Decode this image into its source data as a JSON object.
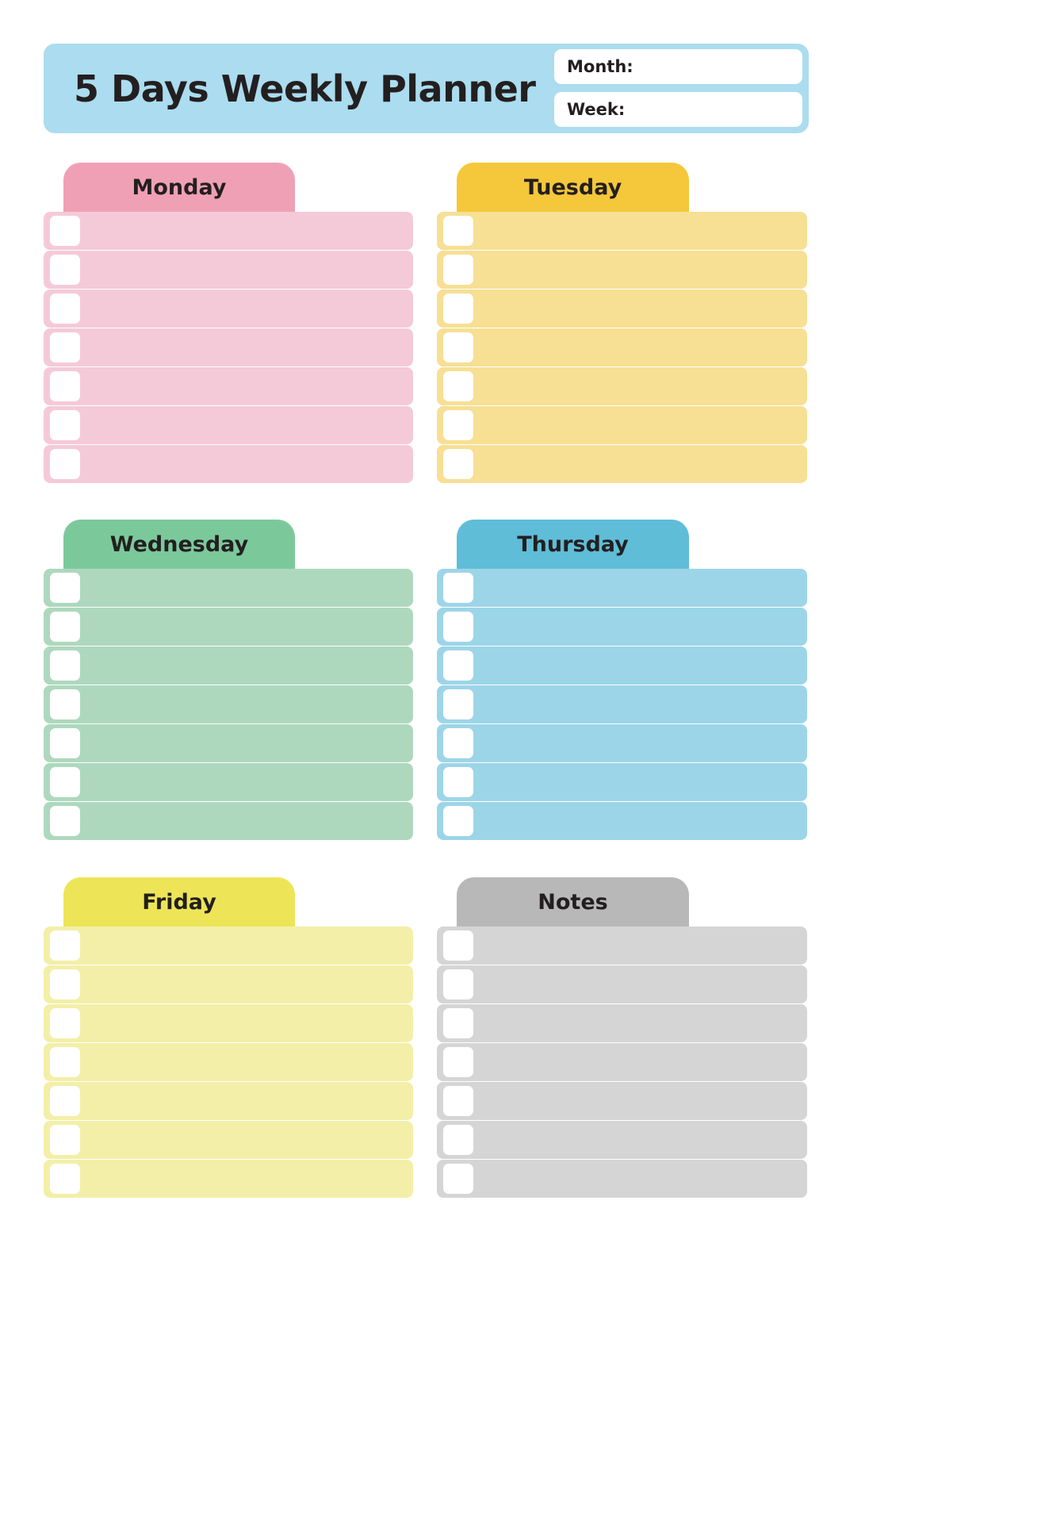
{
  "header": {
    "title": "5 Days Weekly Planner",
    "background_color": "#ABDCEF",
    "fields": [
      {
        "label": "Month:",
        "value": ""
      },
      {
        "label": "Week:",
        "value": ""
      }
    ]
  },
  "cards": [
    {
      "id": "monday",
      "title": "Monday",
      "tab_color": "#F0A0B4",
      "body_color": "#F5CAD8",
      "row_count": 7,
      "rows": [
        "",
        "",
        "",
        "",
        "",
        "",
        ""
      ]
    },
    {
      "id": "tuesday",
      "title": "Tuesday",
      "tab_color": "#F5C73A",
      "body_color": "#F7DF94",
      "row_count": 7,
      "rows": [
        "",
        "",
        "",
        "",
        "",
        "",
        ""
      ]
    },
    {
      "id": "wednesday",
      "title": "Wednesday",
      "tab_color": "#7BC99B",
      "body_color": "#AED8BE",
      "row_count": 7,
      "rows": [
        "",
        "",
        "",
        "",
        "",
        "",
        ""
      ]
    },
    {
      "id": "thursday",
      "title": "Thursday",
      "tab_color": "#5FBDD8",
      "body_color": "#9DD5E8",
      "row_count": 7,
      "rows": [
        "",
        "",
        "",
        "",
        "",
        "",
        ""
      ]
    },
    {
      "id": "friday",
      "title": "Friday",
      "tab_color": "#EDE557",
      "body_color": "#F3EFA8",
      "row_count": 7,
      "rows": [
        "",
        "",
        "",
        "",
        "",
        "",
        ""
      ]
    },
    {
      "id": "notes",
      "title": "Notes",
      "tab_color": "#B8B8B8",
      "body_color": "#D5D5D5",
      "row_count": 7,
      "rows": [
        "",
        "",
        "",
        "",
        "",
        "",
        ""
      ]
    }
  ]
}
